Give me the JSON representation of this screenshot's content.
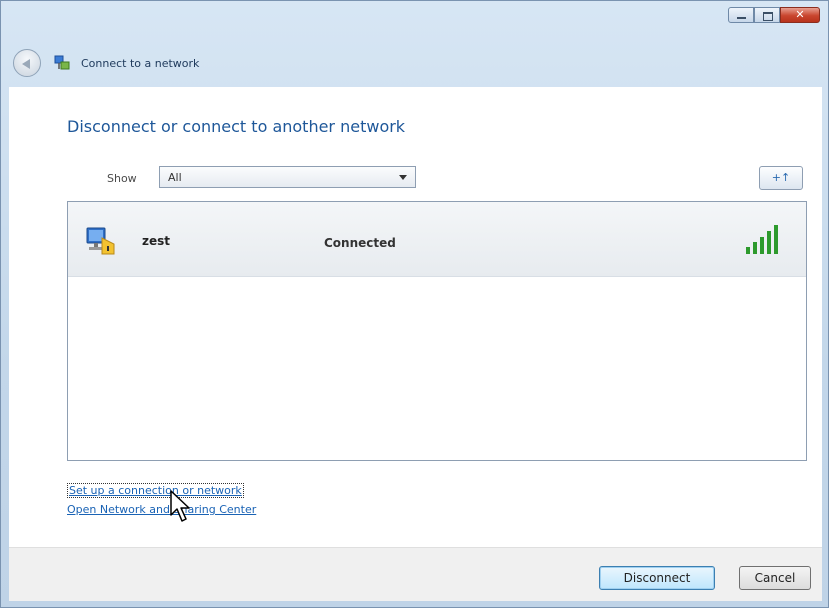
{
  "window": {
    "title": "Connect to a network",
    "controls": {
      "minimize": "–",
      "maximize": "□",
      "close": "✕"
    }
  },
  "main": {
    "heading": "Disconnect or connect to another network",
    "show_label": "Show",
    "show_select_value": "All",
    "refresh_label": "+↑",
    "networks": [
      {
        "name": "zest",
        "status": "Connected",
        "icon": "wireless-network-icon",
        "signal_bars": 5
      }
    ]
  },
  "links": {
    "setup": "Set up a connection or network",
    "open_center": "Open Network and Sharing Center"
  },
  "footer": {
    "disconnect": "Disconnect",
    "cancel": "Cancel"
  },
  "colors": {
    "heading": "#1e5799",
    "link": "#1a63b5",
    "signal": "#2d9a2d"
  }
}
